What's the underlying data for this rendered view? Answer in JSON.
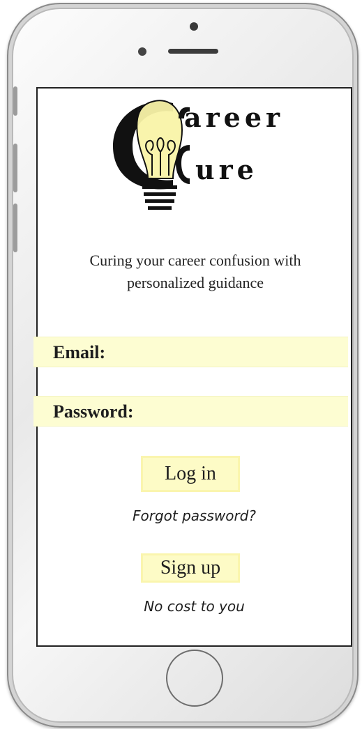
{
  "app": {
    "logo_letters_top": "areer",
    "logo_letters_bottom": "ure",
    "tagline_line1": "Curing your career confusion with",
    "tagline_line2": "personalized guidance"
  },
  "form": {
    "email_label": "Email:",
    "email_value": "",
    "password_label": "Password:",
    "password_value": "",
    "login_label": "Log in",
    "forgot_label": "Forgot password?",
    "signup_label": "Sign up",
    "no_cost_label": "No cost to you"
  },
  "colors": {
    "accent_yellow": "#fdfdd2",
    "button_yellow": "#fdfbc6",
    "text": "#1e1e1e"
  },
  "icons": [
    "lightbulb-icon"
  ]
}
